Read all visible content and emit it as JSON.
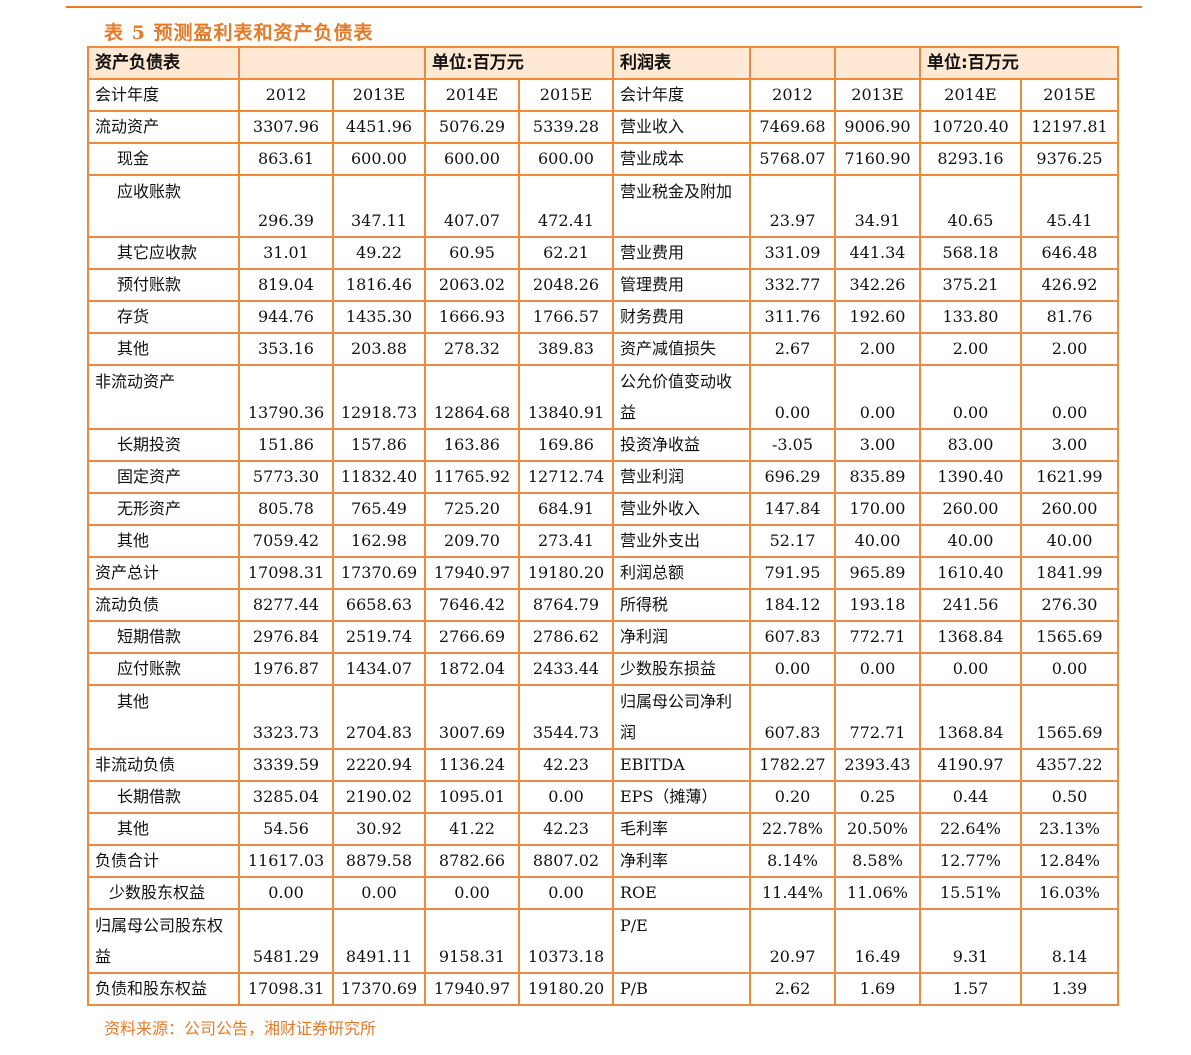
{
  "caption": "表 5 预测盈利表和资产负债表",
  "source": "资料来源：公司公告，湘财证券研究所",
  "header": {
    "left_title": "资产负债表",
    "left_unit": "单位:百万元",
    "right_title": "利润表",
    "right_unit": "单位:百万元"
  },
  "years_label_left": "会计年度",
  "years_label_right": "会计年度",
  "years": [
    "2012",
    "2013E",
    "2014E",
    "2015E"
  ],
  "rows": [
    {
      "l_label": "流动资产",
      "l_indent": 0,
      "l_vals": [
        "3307.96",
        "4451.96",
        "5076.29",
        "5339.28"
      ],
      "r_label": "营业收入",
      "r_vals": [
        "7469.68",
        "9006.90",
        "10720.40",
        "12197.81"
      ]
    },
    {
      "l_label": "现金",
      "l_indent": 1,
      "l_vals": [
        "863.61",
        "600.00",
        "600.00",
        "600.00"
      ],
      "r_label": "营业成本",
      "r_vals": [
        "5768.07",
        "7160.90",
        "8293.16",
        "9376.25"
      ]
    },
    {
      "l_label": "应收账款",
      "l_indent": 1,
      "l_vals": [
        "296.39",
        "347.11",
        "407.07",
        "472.41"
      ],
      "r_label": "营业税金及附加",
      "r_vals": [
        "23.97",
        "34.91",
        "40.65",
        "45.41"
      ],
      "tall": true
    },
    {
      "l_label": "其它应收款",
      "l_indent": 1,
      "l_vals": [
        "31.01",
        "49.22",
        "60.95",
        "62.21"
      ],
      "r_label": "营业费用",
      "r_vals": [
        "331.09",
        "441.34",
        "568.18",
        "646.48"
      ]
    },
    {
      "l_label": "预付账款",
      "l_indent": 1,
      "l_vals": [
        "819.04",
        "1816.46",
        "2063.02",
        "2048.26"
      ],
      "r_label": "管理费用",
      "r_vals": [
        "332.77",
        "342.26",
        "375.21",
        "426.92"
      ]
    },
    {
      "l_label": "存货",
      "l_indent": 1,
      "l_vals": [
        "944.76",
        "1435.30",
        "1666.93",
        "1766.57"
      ],
      "r_label": "财务费用",
      "r_vals": [
        "311.76",
        "192.60",
        "133.80",
        "81.76"
      ]
    },
    {
      "l_label": "其他",
      "l_indent": 1,
      "l_vals": [
        "353.16",
        "203.88",
        "278.32",
        "389.83"
      ],
      "r_label": "资产减值损失",
      "r_vals": [
        "2.67",
        "2.00",
        "2.00",
        "2.00"
      ]
    },
    {
      "l_label": "非流动资产",
      "l_indent": 0,
      "l_vals": [
        "13790.36",
        "12918.73",
        "12864.68",
        "13840.91"
      ],
      "r_label": "公允价值变动收益",
      "r_vals": [
        "0.00",
        "0.00",
        "0.00",
        "0.00"
      ],
      "tall": true
    },
    {
      "l_label": "长期投资",
      "l_indent": 1,
      "l_vals": [
        "151.86",
        "157.86",
        "163.86",
        "169.86"
      ],
      "r_label": "投资净收益",
      "r_vals": [
        "-3.05",
        "3.00",
        "83.00",
        "3.00"
      ]
    },
    {
      "l_label": "固定资产",
      "l_indent": 1,
      "l_vals": [
        "5773.30",
        "11832.40",
        "11765.92",
        "12712.74"
      ],
      "r_label": "营业利润",
      "r_vals": [
        "696.29",
        "835.89",
        "1390.40",
        "1621.99"
      ]
    },
    {
      "l_label": "无形资产",
      "l_indent": 1,
      "l_vals": [
        "805.78",
        "765.49",
        "725.20",
        "684.91"
      ],
      "r_label": "营业外收入",
      "r_vals": [
        "147.84",
        "170.00",
        "260.00",
        "260.00"
      ]
    },
    {
      "l_label": "其他",
      "l_indent": 1,
      "l_vals": [
        "7059.42",
        "162.98",
        "209.70",
        "273.41"
      ],
      "r_label": "营业外支出",
      "r_vals": [
        "52.17",
        "40.00",
        "40.00",
        "40.00"
      ]
    },
    {
      "l_label": "资产总计",
      "l_indent": 0,
      "l_vals": [
        "17098.31",
        "17370.69",
        "17940.97",
        "19180.20"
      ],
      "r_label": "利润总额",
      "r_vals": [
        "791.95",
        "965.89",
        "1610.40",
        "1841.99"
      ]
    },
    {
      "l_label": "流动负债",
      "l_indent": 0,
      "l_vals": [
        "8277.44",
        "6658.63",
        "7646.42",
        "8764.79"
      ],
      "r_label": "所得税",
      "r_vals": [
        "184.12",
        "193.18",
        "241.56",
        "276.30"
      ]
    },
    {
      "l_label": "短期借款",
      "l_indent": 1,
      "l_vals": [
        "2976.84",
        "2519.74",
        "2766.69",
        "2786.62"
      ],
      "r_label": "净利润",
      "r_vals": [
        "607.83",
        "772.71",
        "1368.84",
        "1565.69"
      ]
    },
    {
      "l_label": "应付账款",
      "l_indent": 1,
      "l_vals": [
        "1976.87",
        "1434.07",
        "1872.04",
        "2433.44"
      ],
      "r_label": "少数股东损益",
      "r_vals": [
        "0.00",
        "0.00",
        "0.00",
        "0.00"
      ]
    },
    {
      "l_label": "其他",
      "l_indent": 1,
      "l_vals": [
        "3323.73",
        "2704.83",
        "3007.69",
        "3544.73"
      ],
      "r_label": "归属母公司净利润",
      "r_vals": [
        "607.83",
        "772.71",
        "1368.84",
        "1565.69"
      ],
      "tall": true
    },
    {
      "l_label": "非流动负债",
      "l_indent": 0,
      "l_vals": [
        "3339.59",
        "2220.94",
        "1136.24",
        "42.23"
      ],
      "r_label": "EBITDA",
      "r_vals": [
        "1782.27",
        "2393.43",
        "4190.97",
        "4357.22"
      ]
    },
    {
      "l_label": "长期借款",
      "l_indent": 1,
      "l_vals": [
        "3285.04",
        "2190.02",
        "1095.01",
        "0.00"
      ],
      "r_label": "EPS（摊薄）",
      "r_vals": [
        "0.20",
        "0.25",
        "0.44",
        "0.50"
      ]
    },
    {
      "l_label": "其他",
      "l_indent": 1,
      "l_vals": [
        "54.56",
        "30.92",
        "41.22",
        "42.23"
      ],
      "r_label": "毛利率",
      "r_vals": [
        "22.78%",
        "20.50%",
        "22.64%",
        "23.13%"
      ]
    },
    {
      "l_label": "负债合计",
      "l_indent": 0,
      "l_vals": [
        "11617.03",
        "8879.58",
        "8782.66",
        "8807.02"
      ],
      "r_label": "净利率",
      "r_vals": [
        "8.14%",
        "8.58%",
        "12.77%",
        "12.84%"
      ]
    },
    {
      "l_label": "少数股东权益",
      "l_indent": 2,
      "l_vals": [
        "0.00",
        "0.00",
        "0.00",
        "0.00"
      ],
      "r_label": "ROE",
      "r_vals": [
        "11.44%",
        "11.06%",
        "15.51%",
        "16.03%"
      ]
    },
    {
      "l_label": "归属母公司股东权益",
      "l_indent": 0,
      "l_vals": [
        "5481.29",
        "8491.11",
        "9158.31",
        "10373.18"
      ],
      "r_label": "P/E",
      "r_vals": [
        "20.97",
        "16.49",
        "9.31",
        "8.14"
      ],
      "tall": true
    },
    {
      "l_label": "负债和股东权益",
      "l_indent": 0,
      "l_vals": [
        "17098.31",
        "17370.69",
        "17940.97",
        "19180.20"
      ],
      "r_label": "P/B",
      "r_vals": [
        "2.62",
        "1.69",
        "1.57",
        "1.39"
      ]
    }
  ]
}
